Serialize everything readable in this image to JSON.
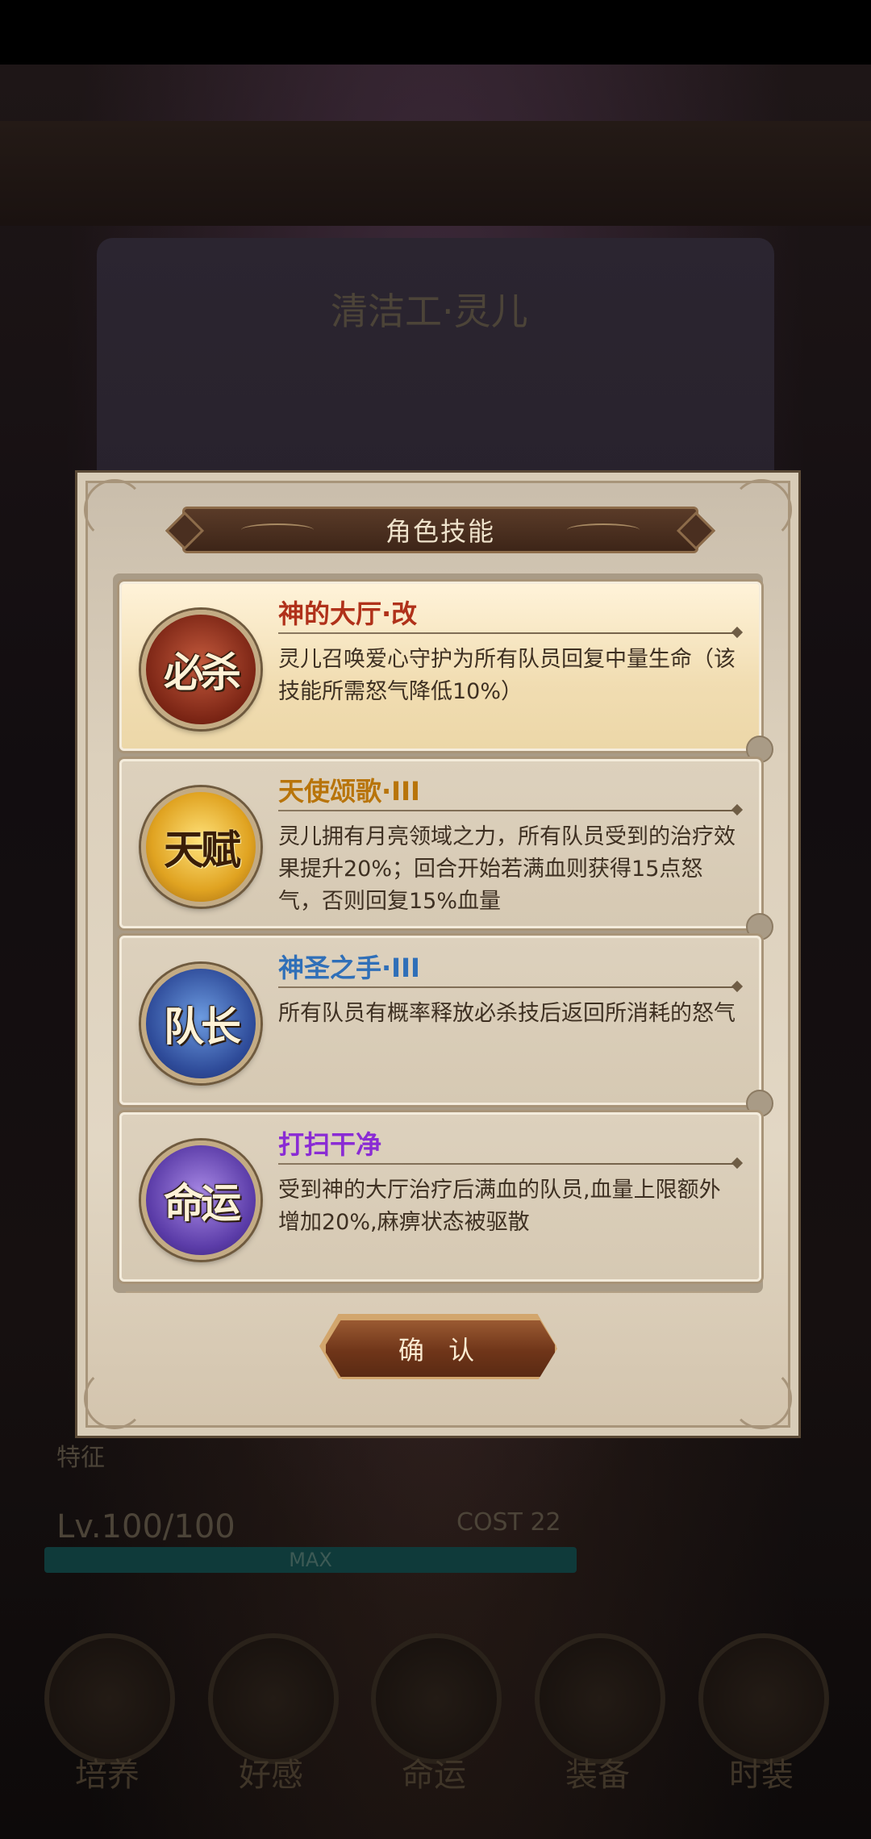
{
  "dialog": {
    "title": "角色技能",
    "confirm_label": "确 认"
  },
  "skills": [
    {
      "type_label": "必杀",
      "name": "神的大厅·改",
      "name_color": "#b0311a",
      "badge_icon": "ultimate-skill-icon",
      "description": "灵儿召唤爱心守护为所有队员回复中量生命（该技能所需怒气降低10%）",
      "selected": true
    },
    {
      "type_label": "天赋",
      "name": "天使颂歌·III",
      "name_color": "#b8740a",
      "badge_icon": "talent-skill-icon",
      "description": "灵儿拥有月亮领域之力，所有队员受到的治疗效果提升20%；回合开始若满血则获得15点怒气，否则回复15%血量",
      "selected": false
    },
    {
      "type_label": "队长",
      "name": "神圣之手·III",
      "name_color": "#2f6fb8",
      "badge_icon": "leader-skill-icon",
      "description": "所有队员有概率释放必杀技后返回所消耗的怒气",
      "selected": false
    },
    {
      "type_label": "命运",
      "name": "打扫干净",
      "name_color": "#8a2bd4",
      "badge_icon": "destiny-skill-icon",
      "description": "受到神的大厅治疗后满血的队员,血量上限额外增加20%,麻痹状态被驱散",
      "selected": false
    }
  ],
  "background": {
    "character_title": "清洁工·灵儿",
    "level_text": "Lv.100/100",
    "cost_text": "COST 22",
    "xp_bar_text": "MAX",
    "feature_label": "特征",
    "nav": [
      "培养",
      "好感",
      "命运",
      "装备",
      "时装"
    ]
  }
}
